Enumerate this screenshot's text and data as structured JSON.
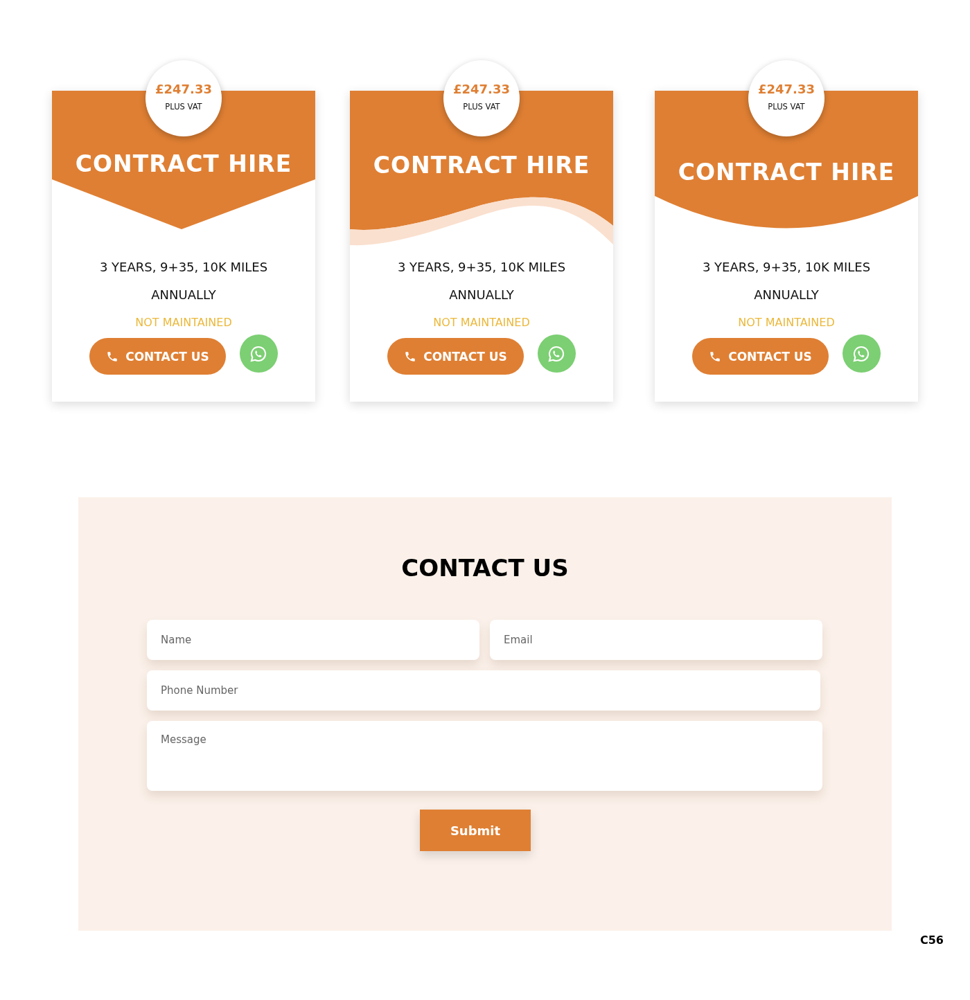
{
  "cards": [
    {
      "kind": "chevron",
      "price": "£247.33",
      "price_note": "PLUS VAT",
      "title": "CONTRACT HIRE",
      "terms": "3 YEARS, 9+35, 10K MILES",
      "frequency": "ANNUALLY",
      "maintenance": "NOT MAINTAINED",
      "contact_button": "CONTACT US"
    },
    {
      "kind": "wave",
      "price": "£247.33",
      "price_note": "PLUS VAT",
      "title": "CONTRACT HIRE",
      "terms": "3 YEARS, 9+35, 10K MILES",
      "frequency": "ANNUALLY",
      "maintenance": "NOT MAINTAINED",
      "contact_button": "CONTACT US"
    },
    {
      "kind": "arc",
      "price": "£247.33",
      "price_note": "PLUS VAT",
      "title": "CONTRACT HIRE",
      "terms": "3 YEARS, 9+35, 10K MILES",
      "frequency": "ANNUALLY",
      "maintenance": "NOT MAINTAINED",
      "contact_button": "CONTACT US"
    }
  ],
  "contact_form": {
    "title": "CONTACT US",
    "fields": [
      {
        "kind": "short",
        "placeholder": "Name"
      },
      {
        "kind": "short",
        "placeholder": "Email"
      },
      {
        "kind": "long",
        "placeholder": "Phone Number"
      },
      {
        "kind": "multiline",
        "placeholder": "Message"
      }
    ],
    "submit": "Submit"
  },
  "page_code": "C56"
}
